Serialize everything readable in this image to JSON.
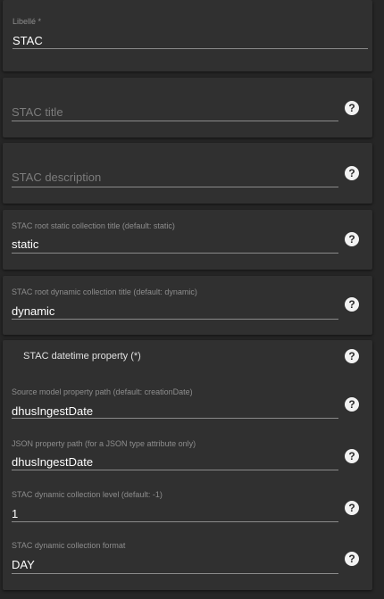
{
  "fields": {
    "libelle": {
      "label": "Libellé *",
      "value": "STAC"
    },
    "stac_title": {
      "placeholder": "STAC title"
    },
    "stac_description": {
      "placeholder": "STAC description"
    },
    "static_title": {
      "label": "STAC root static collection title (default: static)",
      "value": "static"
    },
    "dynamic_title": {
      "label": "STAC root dynamic collection title (default: dynamic)",
      "value": "dynamic"
    }
  },
  "datetime": {
    "title": "STAC datetime property (*)",
    "source_path": {
      "label": "Source model property path (default: creationDate)",
      "value": "dhusIngestDate"
    },
    "json_path": {
      "label": "JSON property path (for a JSON type attribute only)",
      "value": "dhusIngestDate"
    },
    "level": {
      "label": "STAC dynamic collection level (default: -1)",
      "value": "1"
    },
    "format": {
      "label": "STAC dynamic collection format",
      "value": "DAY"
    }
  },
  "help_glyph": "?",
  "icons": {
    "help": "help-circle-icon"
  },
  "colors": {
    "background": "#262626",
    "card": "#303030",
    "help_icon": "#f2f2f2"
  }
}
